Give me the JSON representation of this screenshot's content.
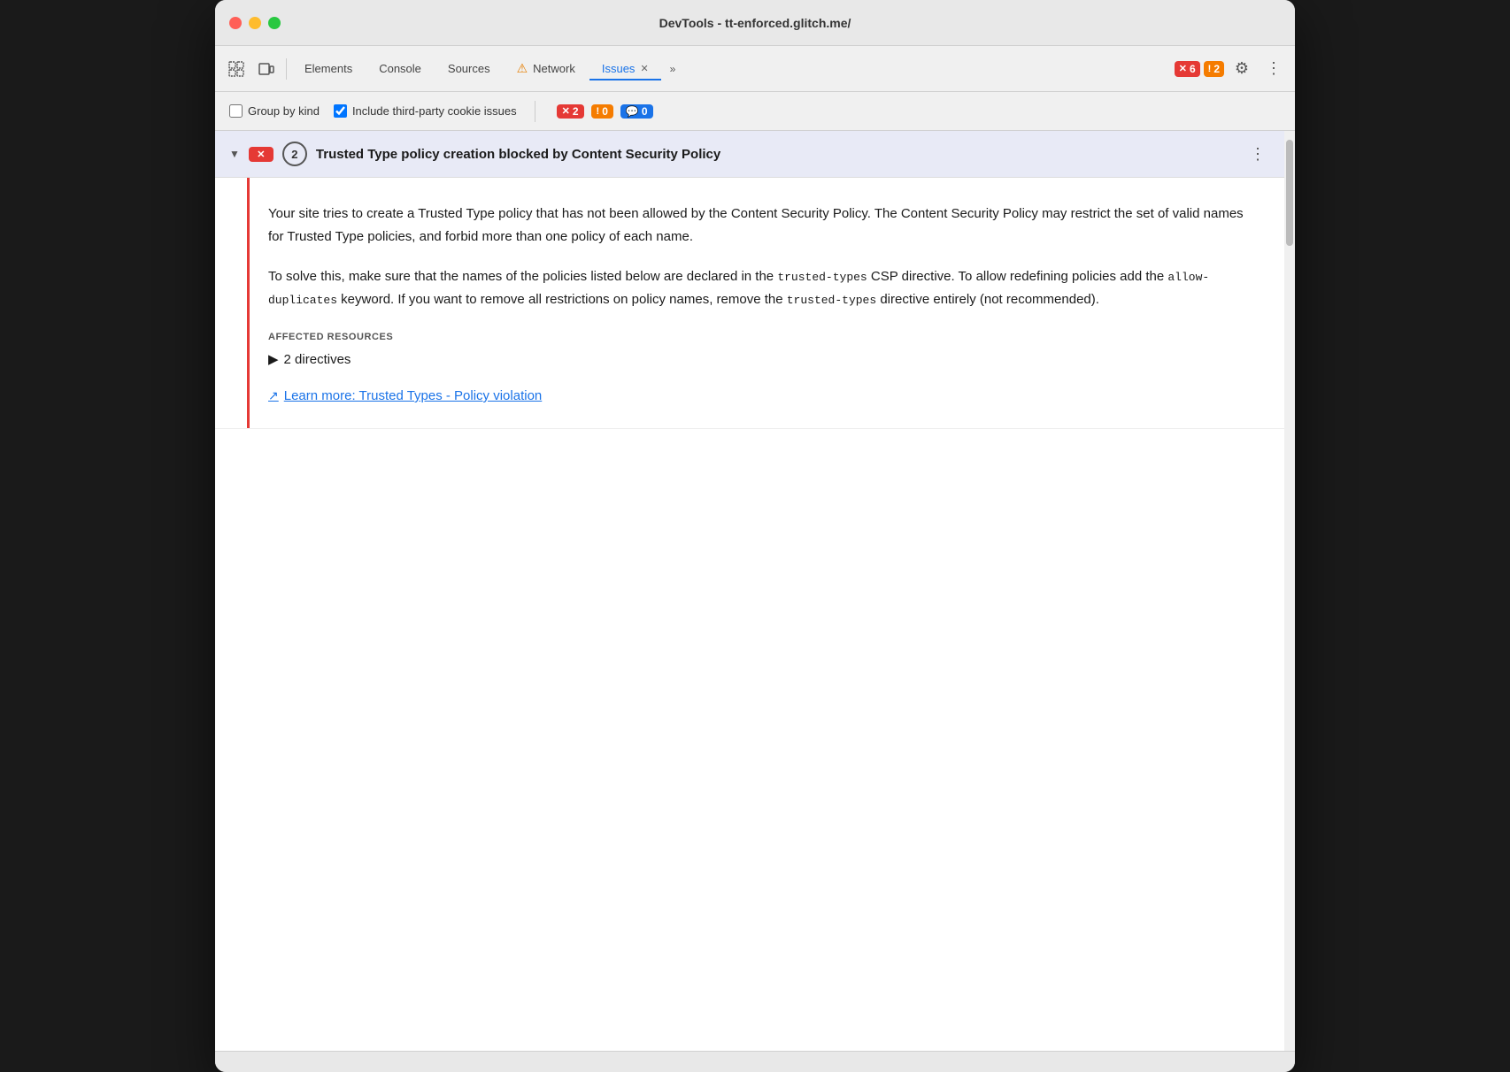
{
  "window": {
    "title": "DevTools - tt-enforced.glitch.me/"
  },
  "traffic_lights": {
    "red": "close",
    "yellow": "minimize",
    "green": "maximize"
  },
  "tabs": {
    "items": [
      {
        "label": "Elements",
        "active": false,
        "icon": null
      },
      {
        "label": "Console",
        "active": false,
        "icon": null
      },
      {
        "label": "Sources",
        "active": false,
        "icon": null
      },
      {
        "label": "Network",
        "active": false,
        "icon": "⚠",
        "icon_color": "#e67e00"
      },
      {
        "label": "Issues",
        "active": true,
        "closeable": true
      },
      {
        "label": "»",
        "more": true
      }
    ],
    "errors_badge": "6",
    "warnings_badge": "2",
    "gear_label": "⚙",
    "more_label": "⋮"
  },
  "filter_bar": {
    "group_by_kind_label": "Group by kind",
    "group_by_kind_checked": false,
    "include_third_party_label": "Include third-party cookie issues",
    "include_third_party_checked": true,
    "badges": [
      {
        "type": "red",
        "icon": "✕",
        "count": "2"
      },
      {
        "type": "orange",
        "icon": "!",
        "count": "0"
      },
      {
        "type": "blue",
        "icon": "💬",
        "count": "0"
      }
    ]
  },
  "issue": {
    "group_header": {
      "badge_icon": "✕",
      "count": "2",
      "title": "Trusted Type policy creation blocked by Content Security Policy",
      "more_icon": "⋮"
    },
    "description": "Your site tries to create a Trusted Type policy that has not been allowed by the Content Security Policy. The Content Security Policy may restrict the set of valid names for Trusted Type policies, and forbid more than one policy of each name.",
    "solution_before_code1": "To solve this, make sure that the names of the policies listed below are declared in the ",
    "solution_code1": "trusted-types",
    "solution_middle1": " CSP directive. To allow redefining policies add the ",
    "solution_code2": "allow-\nduplicates",
    "solution_middle2": " keyword. If you want to remove all restrictions on policy names, remove the ",
    "solution_code3": "trusted-types",
    "solution_after": " directive entirely (not recommended).",
    "solution_text": "To solve this, make sure that the names of the policies listed below are declared in the trusted-types CSP directive. To allow redefining policies add the allow-duplicates keyword. If you want to remove all restrictions on policy names, remove the trusted-types directive entirely (not recommended).",
    "affected_resources_label": "AFFECTED RESOURCES",
    "directives_label": "2 directives",
    "learn_more_label": "Learn more: Trusted Types - Policy violation",
    "learn_more_url": "#"
  }
}
